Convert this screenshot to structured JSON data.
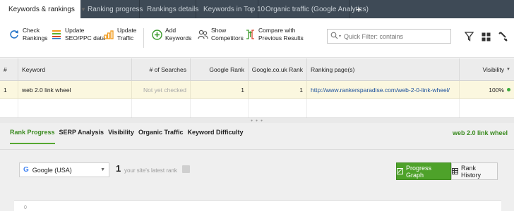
{
  "tabs": [
    {
      "label": "Keywords & rankings",
      "active": true
    },
    {
      "label": "Ranking progress"
    },
    {
      "label": "Rankings details"
    },
    {
      "label": "Keywords in Top 10"
    },
    {
      "label": "Organic traffic (Google Analytics)"
    }
  ],
  "toolbar": {
    "check_rankings": "Check\nRankings",
    "update_seo": "Update\nSEO/PPC data",
    "update_traffic": "Update\nTraffic",
    "add_keywords": "Add\nKeywords",
    "show_competitors": "Show\nCompetitors",
    "compare": "Compare with\nPrevious Results",
    "quick_filter_placeholder": "Quick Filter: contains"
  },
  "table": {
    "headers": {
      "num": "#",
      "keyword": "Keyword",
      "searches": "# of Searches",
      "google_rank": "Google Rank",
      "google_couk_rank": "Google.co.uk Rank",
      "ranking_page": "Ranking page(s)",
      "visibility": "Visibility"
    },
    "rows": [
      {
        "num": "1",
        "keyword": "web 2.0 link wheel",
        "searches": "Not yet checked",
        "google_rank": "1",
        "google_couk_rank": "1",
        "ranking_page": "http://www.rankersparadise.com/web-2-0-link-wheel/",
        "visibility": "100%"
      }
    ]
  },
  "panel": {
    "subtabs": [
      "Rank Progress",
      "SERP Analysis",
      "Visibility",
      "Organic Traffic",
      "Keyword Difficulty"
    ],
    "active_subtab": "Rank Progress",
    "keyword": "web 2.0 link wheel",
    "engine": "Google (USA)",
    "latest_rank": "1",
    "latest_rank_label": "your site's latest rank",
    "btn_progress_graph": "Progress Graph",
    "btn_rank_history": "Rank History",
    "chart_tick": "0"
  },
  "colors": {
    "tabbar_bg": "#3e4a56",
    "accent_green": "#4ea22a",
    "selected_row": "#fbf7df",
    "link": "#1a4f9c"
  }
}
